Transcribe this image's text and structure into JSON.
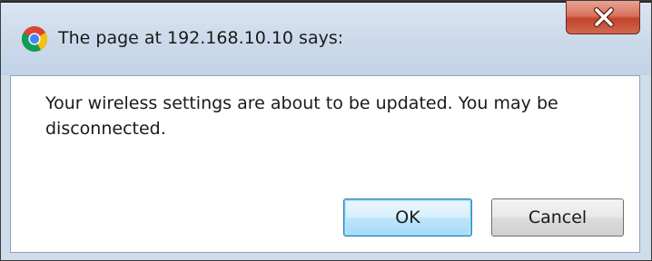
{
  "dialog": {
    "title": "The page at 192.168.10.10 says:",
    "app_icon": "chrome-icon",
    "close_icon": "close-icon",
    "message": "Your wireless settings are about to be updated. You may be disconnected.",
    "buttons": {
      "ok_label": "OK",
      "cancel_label": "Cancel"
    }
  },
  "colors": {
    "titlebar": "#cbd9ea",
    "close_button": "#c2432b",
    "ok_focus_border": "#3c7fb1",
    "client_background": "#ffffff"
  }
}
